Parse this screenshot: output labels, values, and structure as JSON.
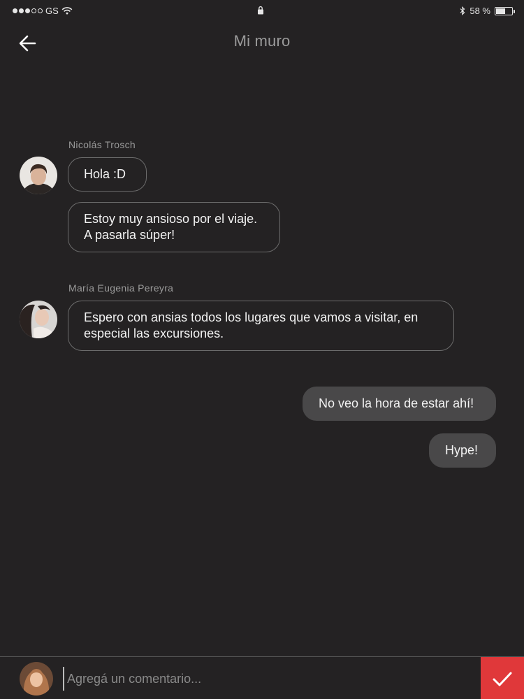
{
  "status_bar": {
    "carrier": "GS",
    "battery_text": "58 %",
    "battery_level": 0.58
  },
  "header": {
    "title": "Mi muro",
    "back_icon": "arrow-left-icon"
  },
  "messages": [
    {
      "sender": "Nicolás Trosch",
      "bubbles": [
        "Hola :D",
        "Estoy muy ansioso por el viaje.\nA pasarla súper!"
      ]
    },
    {
      "sender": "María Eugenia Pereyra",
      "bubbles": [
        "Espero con ansias todos los lugares que vamos a visitar, en\nespecial las excursiones."
      ]
    }
  ],
  "my_messages": [
    "No veo la hora de estar ahí!",
    "Hype!"
  ],
  "comment": {
    "placeholder": "Agregá un comentario...",
    "value": "",
    "send_icon": "checkmark-icon"
  },
  "colors": {
    "background": "#242223",
    "accent": "#e0383a",
    "outgoing_bubble": "#494849"
  }
}
